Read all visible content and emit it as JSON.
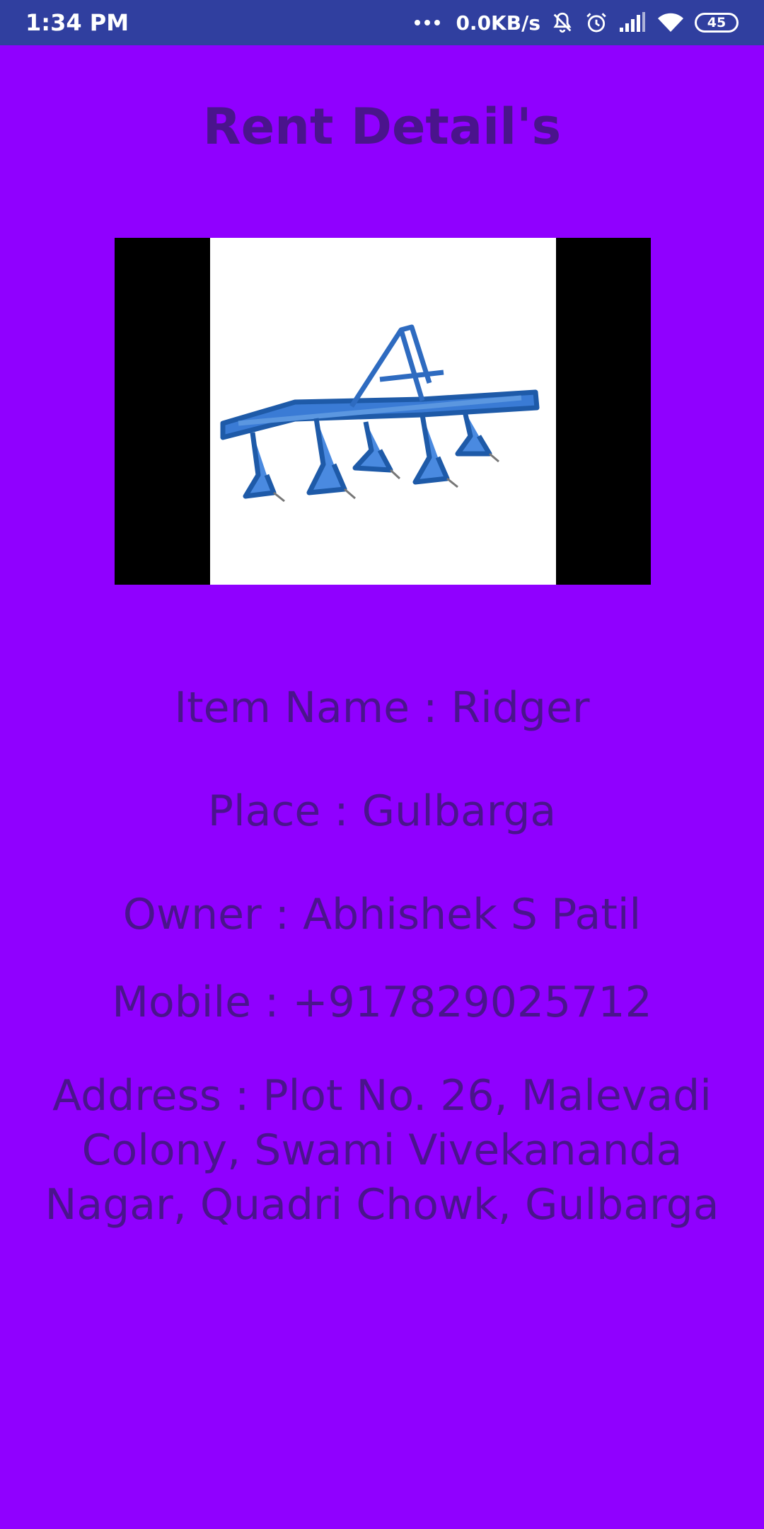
{
  "status_bar": {
    "time": "1:34 PM",
    "network_speed": "0.0KB/s",
    "battery": "45",
    "icons": [
      "more-dots-icon",
      "muted-bell-icon",
      "alarm-icon",
      "signal-icon",
      "wifi-icon",
      "battery-icon"
    ]
  },
  "page": {
    "title": "Rent Detail's"
  },
  "item_image": {
    "icon": "ridger-implement-image"
  },
  "details": {
    "item_name": "Item Name : Ridger",
    "place": "Place : Gulbarga",
    "owner": "Owner : Abhishek S Patil",
    "mobile": "Mobile : +917829025712",
    "address": "Address : Plot No. 26, Malevadi Colony, Swami Vivekananda Nagar, Quadri Chowk, Gulbarga"
  },
  "colors": {
    "background": "#9000FF",
    "status_bar": "#303F9F",
    "text": "#4A148C"
  }
}
